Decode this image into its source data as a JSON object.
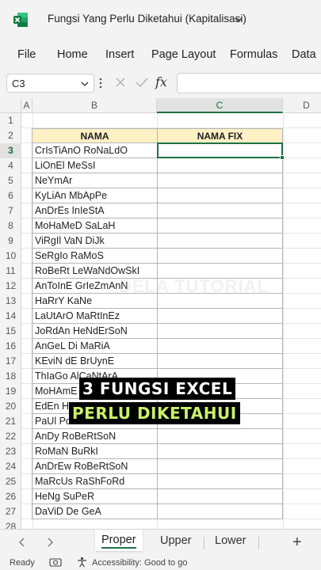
{
  "titlebar": {
    "title": "Fungsi Yang Perlu Diketahui (Kapitalisasi)",
    "app_icon": "excel-logo-icon"
  },
  "ribbon": {
    "tabs": [
      "File",
      "Home",
      "Insert",
      "Page Layout",
      "Formulas",
      "Data"
    ]
  },
  "formula_bar": {
    "name_box": "C3",
    "fx_label": "fx",
    "value": ""
  },
  "columns": [
    "A",
    "B",
    "C",
    "D"
  ],
  "rows": [
    "1",
    "2",
    "3",
    "4",
    "5",
    "6",
    "7",
    "8",
    "9",
    "10",
    "11",
    "12",
    "13",
    "14",
    "15",
    "16",
    "17",
    "18",
    "19",
    "20",
    "21",
    "22",
    "23",
    "24",
    "25",
    "26",
    "27",
    "28"
  ],
  "table": {
    "header_nama": "NAMA",
    "header_nama_fix": "NAMA FIX",
    "names": [
      "CrIsTiAnO RoNaLdO",
      "LiOnEl MeSsI",
      "NeYmAr",
      "KyLiAn MbApPe",
      "AnDrEs InIeStA",
      "MoHaMeD SaLaH",
      "ViRgIl VaN DiJk",
      "SeRgIo RaMoS",
      "RoBeRt LeWaNdOwSkI",
      "AnToInE GrIeZmAnN",
      "HaRrY KaNe",
      "LaUtArO MaRtInEz",
      "JoRdAn HeNdErSoN",
      "AnGeL Di MaRiA",
      "KEviN dE BrUynE",
      "ThIaGo AlCaNtArA",
      "MoHAmE",
      "EdEn HaZa",
      "PaUl Po",
      "AnDy RoBeRtSoN",
      "RoMaN BuRkI",
      "AnDrEw RoBeRtSoN",
      "MaRcUs RaShFoRd",
      "HeNg SuPeR",
      "DaViD De GeA"
    ]
  },
  "watermark": "DELA TUTORIAL",
  "overlay": {
    "line1": "3 FUNGSI EXCEL",
    "line2": "PERLU DIKETAHUI"
  },
  "sheet_tabs": {
    "tabs": [
      "Proper",
      "Upper",
      "Lower"
    ],
    "active": "Proper",
    "add_label": "+"
  },
  "status": {
    "ready": "Ready",
    "accessibility": "Accessibility: Good to go"
  },
  "colors": {
    "accent": "#1e7145",
    "header_fill": "#fdf0c4",
    "overlay_text_1": "#ffffff",
    "overlay_text_2": "#c9f26a"
  }
}
